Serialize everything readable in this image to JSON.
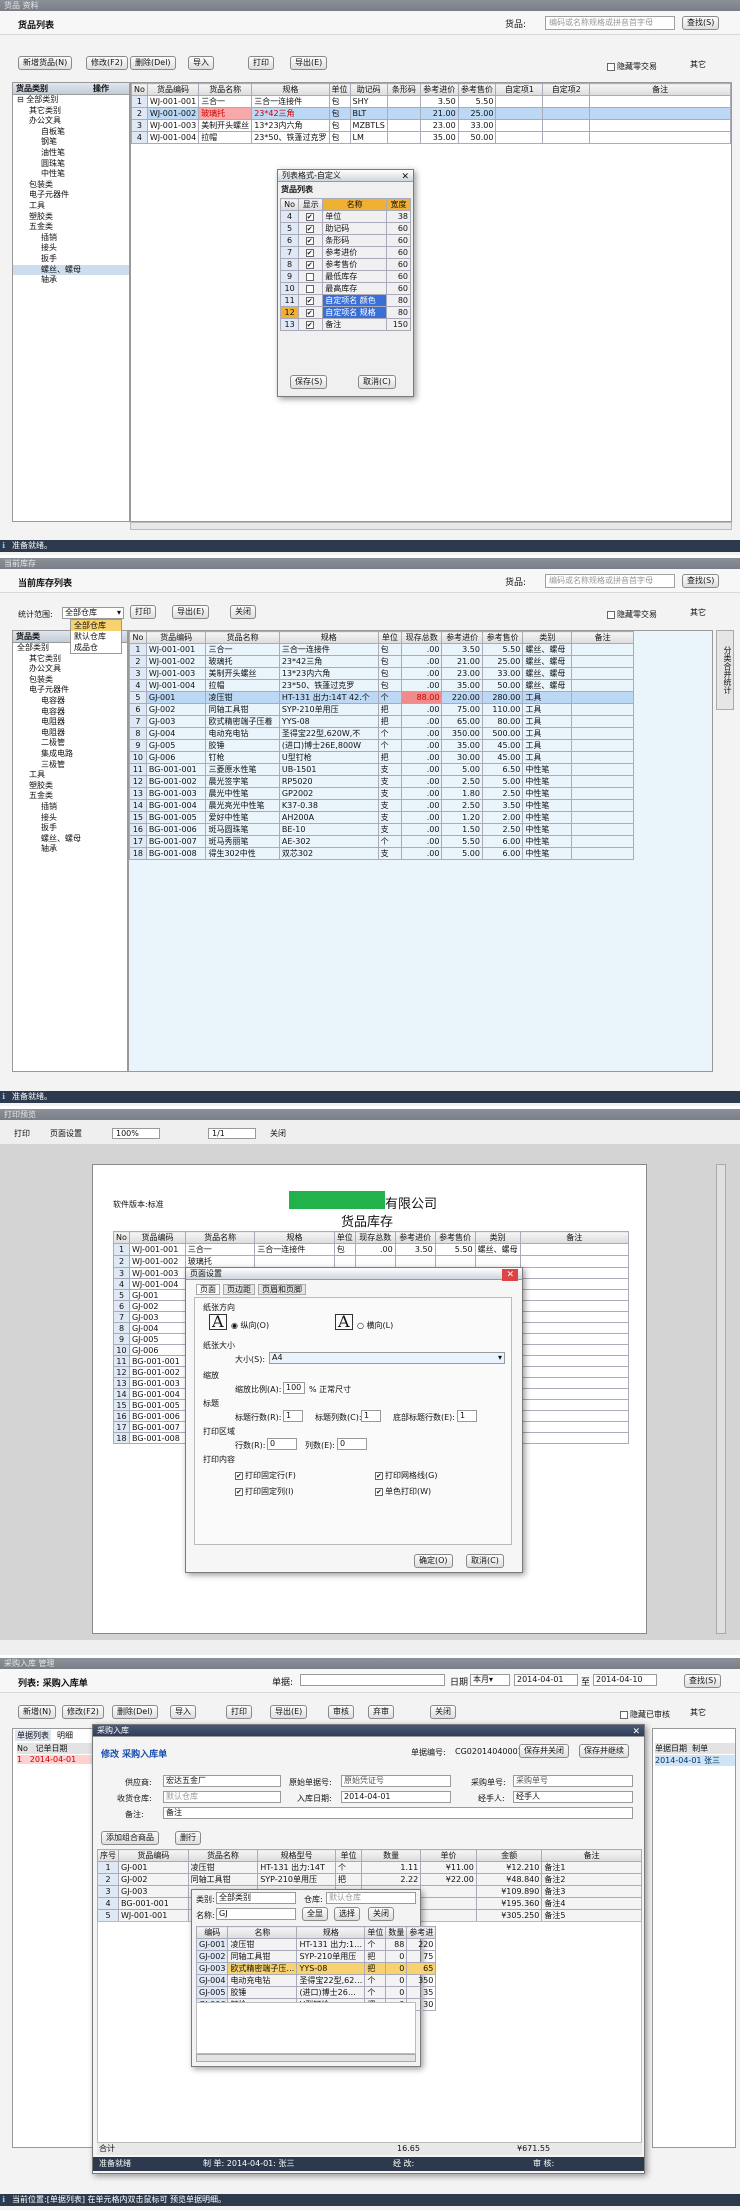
{
  "p1": {
    "window_title": "货品 资料",
    "header_title": "货品列表",
    "search_label": "货品:",
    "search_placeholder": "编码或名称规格或拼音首字母",
    "search_btn": "查找(S)",
    "toolbar": [
      "新增货品(N)",
      "修改(F2)",
      "删除(Del)",
      "导入",
      "打印",
      "导出(E)"
    ],
    "hide_zero": "隐藏零交易",
    "other": "其它",
    "tree_header": "货品类别",
    "tree_op": "操作",
    "tree": [
      "全部类别",
      "其它类别",
      "办公文具",
      "自板笔",
      "钢笔",
      "油性笔",
      "圆珠笔",
      "中性笔",
      "包装类",
      "电子元器件",
      "工具",
      "塑胶类",
      "五金类",
      "插销",
      "接头",
      "扳手",
      "螺丝、螺母",
      "轴承"
    ],
    "cols": [
      "No",
      "货品编码",
      "货品名称",
      "规格",
      "单位",
      "助记码",
      "条形码",
      "参考进价",
      "参考售价",
      "自定项1",
      "自定项2",
      "备注"
    ],
    "rows": [
      [
        "1",
        "WJ-001-001",
        "三合一",
        "三合一连接件",
        "包",
        "SHY",
        "",
        "3.50",
        "5.50"
      ],
      [
        "2",
        "WJ-001-002",
        "玻璃托",
        "23*42三角",
        "包",
        "BLT",
        "",
        "21.00",
        "25.00"
      ],
      [
        "3",
        "WJ-001-003",
        "美制开头螺丝",
        "13*23内六角",
        "包",
        "MZBTLS",
        "",
        "23.00",
        "33.00"
      ],
      [
        "4",
        "WJ-001-004",
        "拉帽",
        "23*50、铁蓬过克罗",
        "包",
        "LM",
        "",
        "35.00",
        "50.00"
      ]
    ],
    "dialog": {
      "title": "列表格式-自定义",
      "section": "货品列表",
      "cols": [
        "No",
        "显示",
        "名称",
        "宽度"
      ],
      "rows": [
        [
          "4",
          "on",
          "单位",
          "38"
        ],
        [
          "5",
          "on",
          "助记码",
          "60"
        ],
        [
          "6",
          "on",
          "条形码",
          "60"
        ],
        [
          "7",
          "on",
          "参考进价",
          "60"
        ],
        [
          "8",
          "on",
          "参考售价",
          "60"
        ],
        [
          "9",
          "off",
          "最低库存",
          "60"
        ],
        [
          "10",
          "off",
          "最高库存",
          "60"
        ],
        [
          "11",
          "on",
          "自定项名 颜色",
          "80"
        ],
        [
          "12",
          "on",
          "自定项名 规格",
          "80"
        ],
        [
          "13",
          "on",
          "备注",
          "150"
        ]
      ],
      "save": "保存(S)",
      "cancel": "取消(C)"
    },
    "status": "准备就绪。"
  },
  "p2": {
    "window_title": "当前库存",
    "header_title": "当前库存列表",
    "search_label": "货品:",
    "search_placeholder": "编码或名称规格或拼音首字母",
    "search_btn": "查找(S)",
    "scope_label": "统计范围:",
    "scope_value": "全部仓库",
    "scope_options": [
      "全部仓库",
      "默认仓库",
      "成品仓"
    ],
    "toolbar": [
      "打印",
      "导出(E)",
      "关闭"
    ],
    "hide_zero": "隐藏零交易",
    "other": "其它",
    "side_tab": "分类合并统计",
    "tree_header": "货品类",
    "tree": [
      "全部类别",
      "其它类别",
      "办公文具",
      "包装类",
      "电子元器件",
      "电容器",
      "电容器",
      "电阻器",
      "电阻器",
      "二极管",
      "集成电路",
      "三极管",
      "工具",
      "塑胶类",
      "五金类",
      "插销",
      "接头",
      "扳手",
      "螺丝、螺母",
      "轴承"
    ],
    "cols": [
      "No",
      "货品编码",
      "货品名称",
      "规格",
      "单位",
      "现存总数",
      "参考进价",
      "参考售价",
      "类别",
      "备注"
    ],
    "rows": [
      [
        "1",
        "WJ-001-001",
        "三合一",
        "三合一连接件",
        "包",
        ".00",
        "3.50",
        "5.50",
        "螺丝、螺母"
      ],
      [
        "2",
        "WJ-001-002",
        "玻璃托",
        "23*42三角",
        "包",
        ".00",
        "21.00",
        "25.00",
        "螺丝、螺母"
      ],
      [
        "3",
        "WJ-001-003",
        "美制开头螺丝",
        "13*23内六角",
        "包",
        ".00",
        "23.00",
        "33.00",
        "螺丝、螺母"
      ],
      [
        "4",
        "WJ-001-004",
        "拉帽",
        "23*50、铁蓬过克罗",
        "包",
        ".00",
        "35.00",
        "50.00",
        "螺丝、螺母"
      ],
      [
        "5",
        "GJ-001",
        "凌压钳",
        "HT-131 出力:14T 42.个",
        "个",
        "88.00",
        "220.00",
        "280.00",
        "工具"
      ],
      [
        "6",
        "GJ-002",
        "同轴工具钳",
        "SYP-210单用压",
        "把",
        ".00",
        "75.00",
        "110.00",
        "工具"
      ],
      [
        "7",
        "GJ-003",
        "欧式精密端子压着",
        "YYS-08",
        "把",
        ".00",
        "65.00",
        "80.00",
        "工具"
      ],
      [
        "8",
        "GJ-004",
        "电动充电钻",
        "圣得宝22型,620W,不",
        "个",
        ".00",
        "350.00",
        "500.00",
        "工具"
      ],
      [
        "9",
        "GJ-005",
        "胶锤",
        "(进口)博士26E,800W",
        "个",
        ".00",
        "35.00",
        "45.00",
        "工具"
      ],
      [
        "10",
        "GJ-006",
        "钉枪",
        "U型钉枪",
        "把",
        ".00",
        "30.00",
        "45.00",
        "工具"
      ],
      [
        "11",
        "BG-001-001",
        "三菱原水性笔",
        "UB-1501",
        "支",
        ".00",
        "5.00",
        "6.50",
        "中性笔"
      ],
      [
        "12",
        "BG-001-002",
        "晨光签字笔",
        "RP5020",
        "支",
        ".00",
        "2.50",
        "5.00",
        "中性笔"
      ],
      [
        "13",
        "BG-001-003",
        "晨光中性笔",
        "GP2002",
        "支",
        ".00",
        "1.80",
        "2.50",
        "中性笔"
      ],
      [
        "14",
        "BG-001-004",
        "晨光亮光中性笔",
        "K37-0.38",
        "支",
        ".00",
        "2.50",
        "3.50",
        "中性笔"
      ],
      [
        "15",
        "BG-001-005",
        "爱好中性笔",
        "AH200A",
        "支",
        ".00",
        "1.20",
        "2.00",
        "中性笔"
      ],
      [
        "16",
        "BG-001-006",
        "斑马圆珠笔",
        "BE-10",
        "支",
        ".00",
        "1.50",
        "2.50",
        "中性笔"
      ],
      [
        "17",
        "BG-001-007",
        "斑马秀丽笔",
        "AE-302",
        "个",
        ".00",
        "5.50",
        "6.00",
        "中性笔"
      ],
      [
        "18",
        "BG-001-008",
        "得生302中性",
        "双芯302",
        "支",
        ".00",
        "5.00",
        "6.00",
        "中性笔"
      ]
    ],
    "status": "准备就绪。"
  },
  "p3": {
    "window_title": "打印预览",
    "toolbar": [
      "打印",
      "页面设置",
      "100%",
      "1/1",
      "关闭"
    ],
    "meta": "软件版本:标准",
    "company_suffix": "有限公司",
    "doc_title": "货品库存",
    "cols": [
      "No",
      "货品编码",
      "货品名称",
      "规格",
      "单位",
      "现存总数",
      "参考进价",
      "参考售价",
      "类别",
      "备注"
    ],
    "rows": [
      [
        "1",
        "WJ-001-001",
        "三合一",
        "三合一连接件",
        "包",
        ".00",
        "3.50",
        "5.50",
        "螺丝、螺母"
      ],
      [
        "2",
        "WJ-001-002",
        "玻璃托",
        "",
        "",
        "",
        "",
        "",
        ""
      ],
      [
        "3",
        "WJ-001-003",
        "",
        "",
        "",
        "",
        "",
        "",
        ""
      ],
      [
        "4",
        "WJ-001-004",
        "",
        "",
        "",
        "",
        "",
        "",
        ""
      ],
      [
        "5",
        "GJ-001"
      ],
      [
        "6",
        "GJ-002"
      ],
      [
        "7",
        "GJ-003"
      ],
      [
        "8",
        "GJ-004"
      ],
      [
        "9",
        "GJ-005"
      ],
      [
        "10",
        "GJ-006"
      ],
      [
        "11",
        "BG-001-001"
      ],
      [
        "12",
        "BG-001-002"
      ],
      [
        "13",
        "BG-001-003"
      ],
      [
        "14",
        "BG-001-004"
      ],
      [
        "15",
        "BG-001-005"
      ],
      [
        "16",
        "BG-001-006"
      ],
      [
        "17",
        "BG-001-007"
      ],
      [
        "18",
        "BG-001-008"
      ]
    ],
    "dialog": {
      "title": "页面设置",
      "tabs": [
        "页面",
        "页边距",
        "页眉和页脚"
      ],
      "orient_label": "纸张方向",
      "portrait": "纵向(O)",
      "landscape": "横向(L)",
      "paper_label": "纸张大小",
      "size_label": "大小(S):",
      "size_value": "A4",
      "scale_label": "缩放",
      "scale_text": "缩放比例(A):",
      "scale_value": "100",
      "scale_suffix": "% 正常尺寸",
      "title_label": "标题",
      "title_rows": "标题行数(R):",
      "title_cols": "标题列数(C):",
      "footer_rows": "底部标题行数(E):",
      "one": "1",
      "area_label": "打印区域",
      "rows_label": "行数(R):",
      "cols_label": "列数(E):",
      "zero": "0",
      "content_label": "打印内容",
      "opt": [
        "打印固定行(F)",
        "打印网格线(G)",
        "打印固定列(I)",
        "单色打印(W)"
      ],
      "ok": "确定(O)",
      "cancel": "取消(C)"
    }
  },
  "p4": {
    "window_title": "采购入库 管理",
    "list_label": "列表: 采购入库单",
    "doc_label": "单据:",
    "date_label": "日期",
    "date_range": "本月",
    "date_from": "2014-04-01",
    "to": "至",
    "date_to": "2014-04-10",
    "search_btn": "查找(S)",
    "toolbar": [
      "新增(N)",
      "修改(F2)",
      "删除(Del)",
      "导入",
      "打印",
      "导出(E)",
      "审核",
      "弃审",
      "关闭"
    ],
    "hide_audit": "隐藏已审核",
    "other": "其它",
    "left_tabs": [
      "单据列表",
      "明细"
    ],
    "left_cols": [
      "No",
      "记单日期"
    ],
    "left_row": [
      "1",
      "2014-04-01"
    ],
    "right_cols": [
      "单据日期",
      "制单"
    ],
    "right_row": [
      "2014-04-01",
      "张三"
    ],
    "dialog": {
      "title": "采购入库",
      "head": "修改 采购入库单",
      "docno_label": "单据编号:",
      "docno": "CG02014040001",
      "save_close": "保存并关闭",
      "save_cont": "保存并继续",
      "supplier_label": "供应商:",
      "supplier": "宏达五金厂",
      "orig_label": "原始单据号:",
      "orig_ph": "原始凭证号",
      "po_label": "采购单号:",
      "po_ph": "采购单号",
      "wh_label": "收货仓库:",
      "wh": "默认仓库",
      "date_label": "入库日期:",
      "date": "2014-04-01",
      "handler_label": "经手人:",
      "handler": "经手人",
      "note_label": "备注:",
      "note": "备注",
      "add_btn": "添加组合商品",
      "del_btn": "删行",
      "cols": [
        "序号",
        "货品编码",
        "货品名称",
        "规格型号",
        "单位",
        "数量",
        "单价",
        "金额",
        "备注"
      ],
      "rows": [
        [
          "1",
          "GJ-001",
          "凌压钳",
          "HT-131 出力:14T",
          "个",
          "1.11",
          "¥11.00",
          "¥12.210",
          "备注1"
        ],
        [
          "2",
          "GJ-002",
          "同轴工具钳",
          "SYP-210单用压",
          "把",
          "2.22",
          "¥22.00",
          "¥48.840",
          "备注2"
        ],
        [
          "3",
          "GJ-003",
          "",
          "",
          "",
          "",
          "",
          "¥109.890",
          "备注3"
        ],
        [
          "4",
          "BG-001-001",
          "",
          "",
          "",
          "",
          "",
          "¥195.360",
          "备注4"
        ],
        [
          "5",
          "WJ-001-001",
          "",
          "",
          "",
          "",
          "",
          "¥305.250",
          "备注5"
        ],
        [
          "6",
          "",
          "",
          "",
          "",
          "",
          "",
          "",
          ""
        ]
      ],
      "total_label": "合计",
      "total_qty": "16.65",
      "total_amt": "¥671.55",
      "popup": {
        "cat_label": "类别:",
        "cat": "全部类别",
        "wh_label": "仓库:",
        "wh": "默认仓库",
        "name_label": "名称:",
        "name": "GJ",
        "all_btn": "全显",
        "choose_btn": "选择",
        "close_btn": "关闭",
        "cols": [
          "编码",
          "名称",
          "规格",
          "单位",
          "数量",
          "参考进"
        ],
        "rows": [
          [
            "GJ-001",
            "凌压钳",
            "HT-131 出力:1…",
            "个",
            "88",
            "220"
          ],
          [
            "GJ-002",
            "同轴工具钳",
            "SYP-210单用压",
            "把",
            "0",
            "75"
          ],
          [
            "GJ-003",
            "欧式精密端子压…",
            "YYS-08",
            "把",
            "0",
            "65"
          ],
          [
            "GJ-004",
            "电动充电钻",
            "圣得宝22型,62…",
            "个",
            "0",
            "350"
          ],
          [
            "GJ-005",
            "胶锤",
            "(进口)博士26…",
            "个",
            "0",
            "35"
          ],
          [
            "GJ-006",
            "钉枪",
            "U型钉枪",
            "把",
            "0",
            "30"
          ]
        ]
      },
      "footer": [
        "准备就绪",
        "制 单: 2014-04-01: 张三",
        "经 改:",
        "审 核:"
      ]
    },
    "status": "当前位置:[单据列表] 在单元格内双击鼠标可 预览单据明细。"
  }
}
